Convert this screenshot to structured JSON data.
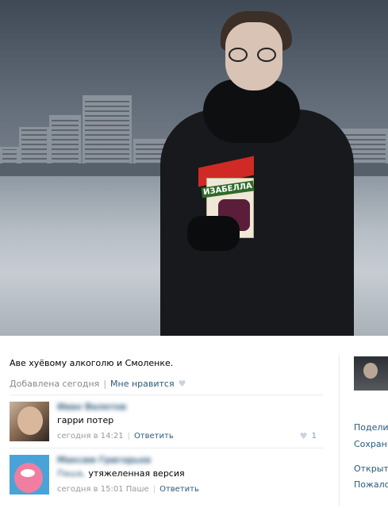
{
  "photo": {
    "carton_text": "ИЗАБЕЛЛА"
  },
  "post": {
    "caption": "Аве хуёвому алкоголю и Смоленке.",
    "added": "Добавлена сегодня",
    "like_label": "Мне нравится"
  },
  "comments": [
    {
      "author": "Иван Валетов",
      "text": "гарри потер",
      "time": "сегодня в 14:21",
      "reply_label": "Ответить",
      "likes": "1"
    },
    {
      "author": "Максим Григорьев",
      "addressee": "Паша,",
      "text": "утяжеленная версия",
      "time": "сегодня в 15:01 Паше",
      "reply_label": "Ответить"
    }
  ],
  "sidebar": {
    "actions": [
      "Поделит",
      "Сохрани",
      "Открыт",
      "Пожалов"
    ]
  },
  "colors": {
    "link": "#2b587a",
    "muted": "#888888"
  }
}
